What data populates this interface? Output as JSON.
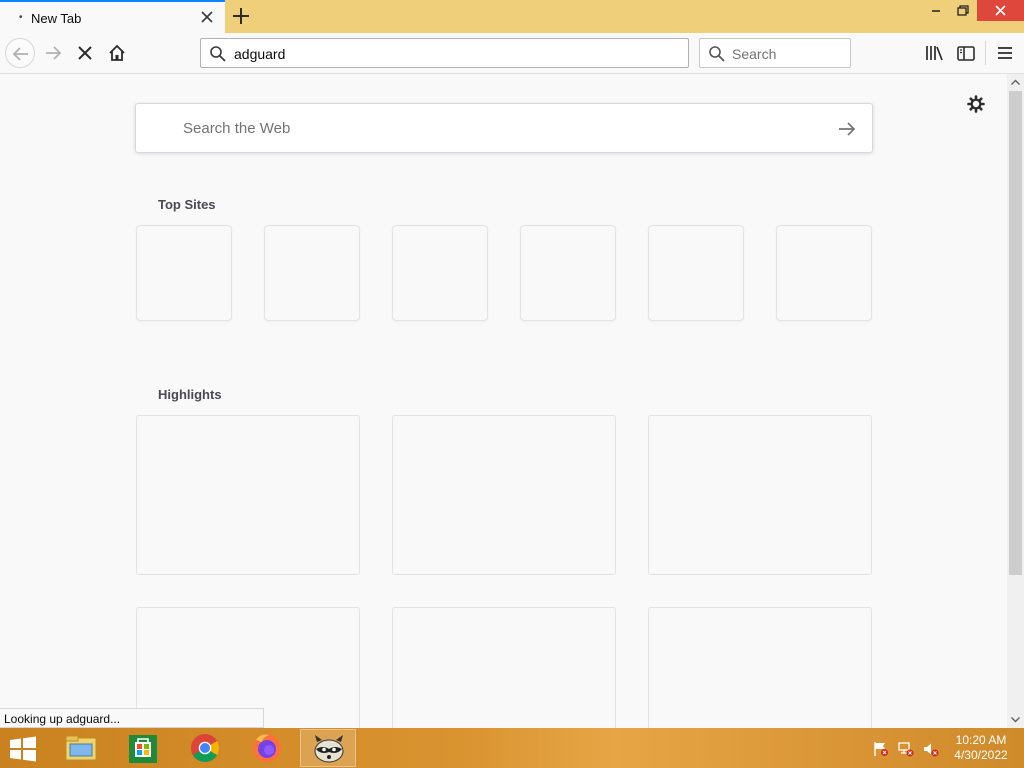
{
  "browser": {
    "tab": {
      "title": "New Tab"
    },
    "url": "adguard",
    "search_placeholder": "Search"
  },
  "newtab": {
    "search_placeholder": "Search the Web",
    "top_sites_title": "Top Sites",
    "highlights_title": "Highlights"
  },
  "status": "Looking up adguard...",
  "taskbar": {
    "time": "10:20 AM",
    "date": "4/30/2022",
    "apps": [
      "file-explorer",
      "store",
      "chrome",
      "firefox",
      "raccoon-app"
    ]
  },
  "colors": {
    "tabstrip": "#f0cf7a",
    "active_tab_accent": "#0a84ff",
    "close_button": "#e0473c",
    "taskbar": "#d99430"
  }
}
